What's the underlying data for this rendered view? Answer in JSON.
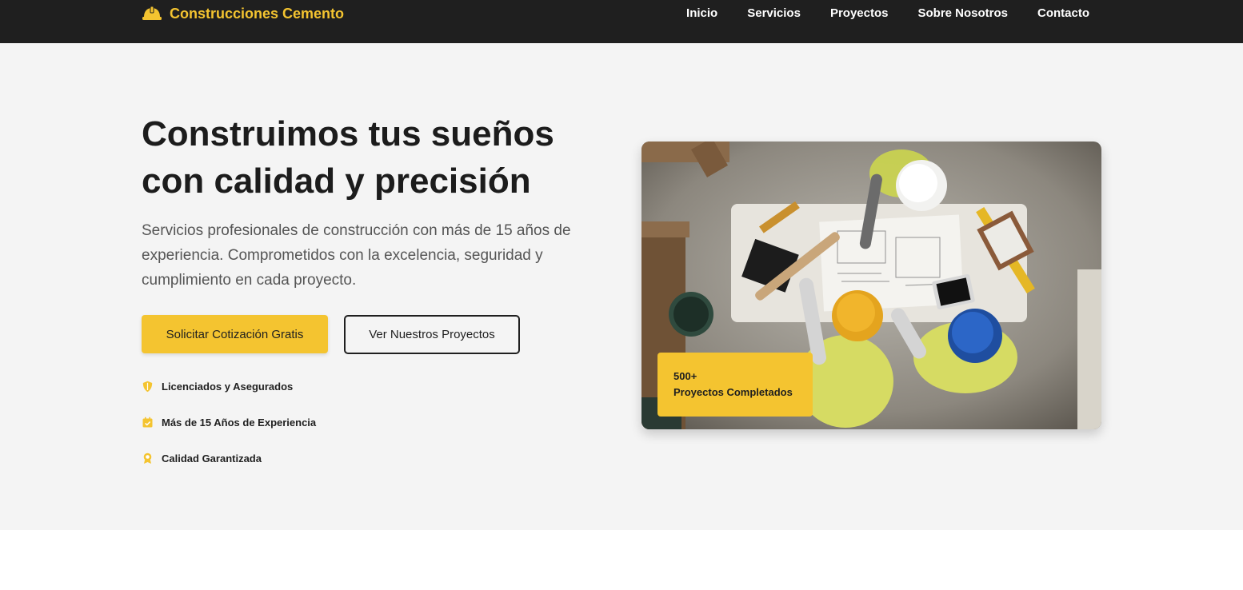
{
  "brand": {
    "name": "Construcciones Cemento",
    "icon": "hard-hat-icon"
  },
  "nav": {
    "links": [
      {
        "label": "Inicio"
      },
      {
        "label": "Servicios"
      },
      {
        "label": "Proyectos"
      },
      {
        "label": "Sobre Nosotros"
      },
      {
        "label": "Contacto"
      }
    ]
  },
  "hero": {
    "title_line1": "Construimos tus sueños",
    "title_line2": "con calidad y precisión",
    "subtitle": "Servicios profesionales de construcción con más de 15 años de experiencia. Comprometidos con la excelencia, seguridad y cumplimiento en cada proyecto.",
    "primary_button": "Solicitar Cotización Gratis",
    "secondary_button": "Ver Nuestros Proyectos",
    "features": [
      {
        "icon": "shield-icon",
        "label": "Licenciados y Asegurados"
      },
      {
        "icon": "calendar-check-icon",
        "label": "Más de 15 Años de Experiencia"
      },
      {
        "icon": "award-icon",
        "label": "Calidad Garantizada"
      }
    ],
    "image_icon": "construction-workers-photo",
    "stat": {
      "number": "500+",
      "label": "Proyectos Completados"
    }
  },
  "colors": {
    "accent": "#f4c430",
    "nav_bg": "#1f1f1f",
    "hero_bg": "#f4f4f4",
    "text_dark": "#1f1f1f",
    "text_muted": "#555555"
  }
}
